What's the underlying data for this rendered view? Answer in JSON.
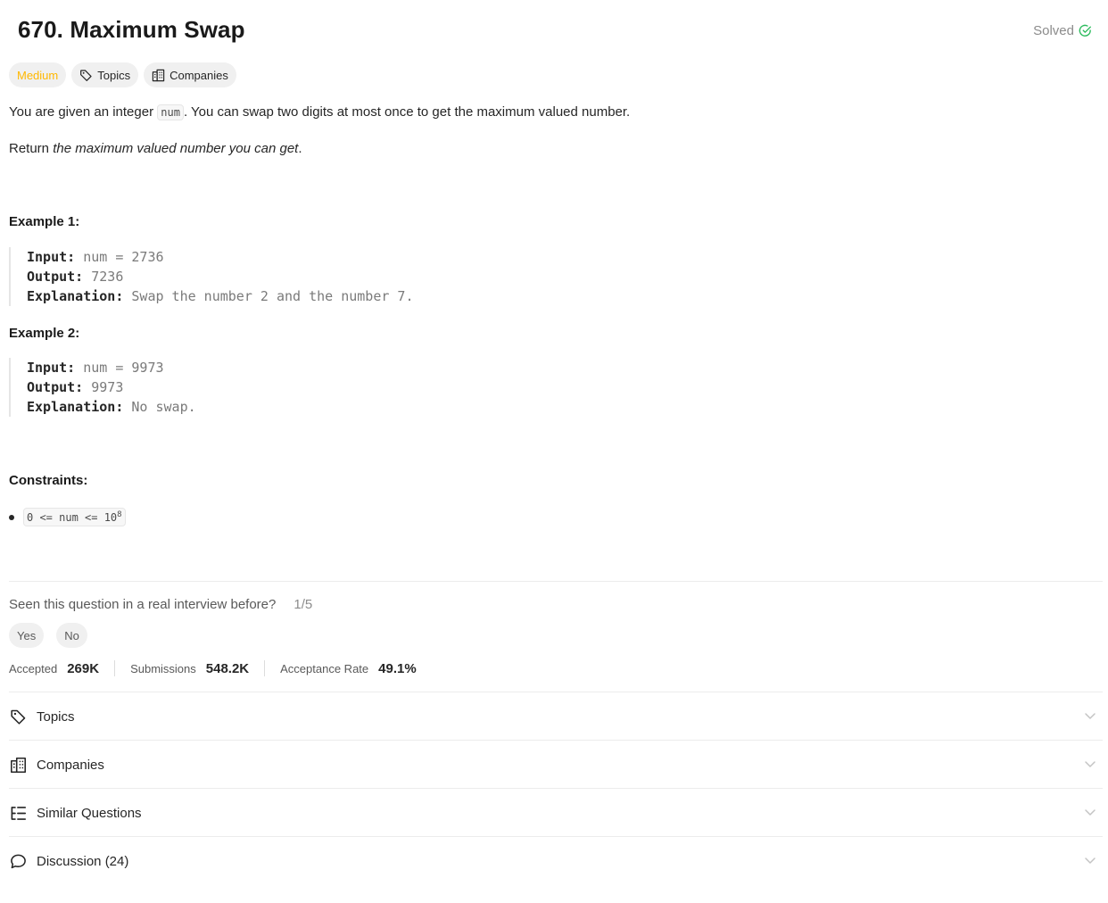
{
  "problem": {
    "title": "670. Maximum Swap",
    "status": "Solved",
    "difficulty": "Medium",
    "tag_topics": "Topics",
    "tag_companies": "Companies"
  },
  "description": {
    "line1_before": "You are given an integer ",
    "line1_code": "num",
    "line1_after": ". You can swap two digits at most once to get the maximum valued number.",
    "line2_before": "Return ",
    "line2_italic": "the maximum valued number you can get",
    "line2_after": "."
  },
  "examples": [
    {
      "title": "Example 1:",
      "input_label": "Input:",
      "input": "num = 2736",
      "output_label": "Output:",
      "output": "7236",
      "explanation_label": "Explanation:",
      "explanation": "Swap the number 2 and the number 7."
    },
    {
      "title": "Example 2:",
      "input_label": "Input:",
      "input": "num = 9973",
      "output_label": "Output:",
      "output": "9973",
      "explanation_label": "Explanation:",
      "explanation": "No swap."
    }
  ],
  "constraints": {
    "title": "Constraints:",
    "item_base": "0 <= num <= 10",
    "item_exp": "8"
  },
  "interview": {
    "question": "Seen this question in a real interview before?",
    "count": "1/5",
    "yes": "Yes",
    "no": "No"
  },
  "stats": {
    "accepted_label": "Accepted",
    "accepted": "269K",
    "submissions_label": "Submissions",
    "submissions": "548.2K",
    "rate_label": "Acceptance Rate",
    "rate": "49.1%"
  },
  "accordion": [
    {
      "label": "Topics",
      "icon": "tag-icon"
    },
    {
      "label": "Companies",
      "icon": "building-icon"
    },
    {
      "label": "Similar Questions",
      "icon": "list-tree-icon"
    },
    {
      "label": "Discussion (24)",
      "icon": "chat-bubble-icon"
    }
  ],
  "colors": {
    "medium": "#ffb800",
    "solved_check": "#2cbb5d"
  }
}
